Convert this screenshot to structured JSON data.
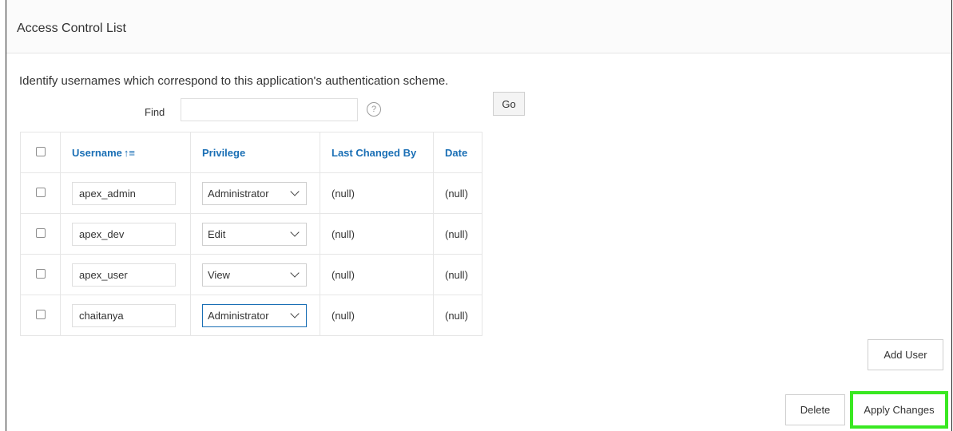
{
  "region": {
    "title": "Access Control List"
  },
  "instructions": "Identify usernames which correspond to this application's authentication scheme.",
  "search": {
    "label": "Find",
    "value": "",
    "placeholder": "",
    "help_icon": "?",
    "go_label": "Go"
  },
  "table": {
    "headers": {
      "username": "Username",
      "privilege": "Privilege",
      "last_changed_by": "Last Changed By",
      "date": "Date"
    },
    "sort_icon": "↑≡",
    "rows": [
      {
        "username": "apex_admin",
        "privilege": "Administrator",
        "last_changed_by": "(null)",
        "date": "(null)"
      },
      {
        "username": "apex_dev",
        "privilege": "Edit",
        "last_changed_by": "(null)",
        "date": "(null)"
      },
      {
        "username": "apex_user",
        "privilege": "View",
        "last_changed_by": "(null)",
        "date": "(null)"
      },
      {
        "username": "chaitanya",
        "privilege": "Administrator",
        "last_changed_by": "(null)",
        "date": "(null)"
      }
    ]
  },
  "buttons": {
    "add_user": "Add User",
    "delete": "Delete",
    "apply_changes": "Apply Changes"
  },
  "colors": {
    "link_header": "#1a6fb5",
    "highlight": "#39e821",
    "border": "#e6e6e6"
  }
}
